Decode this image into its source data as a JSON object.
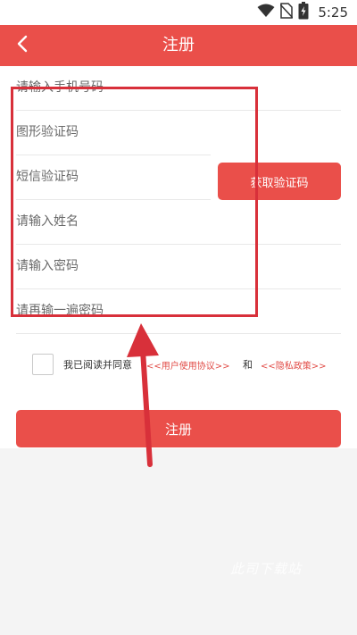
{
  "status_bar": {
    "time": "5:25",
    "icons": [
      "wifi-icon",
      "no-sim-icon",
      "battery-charging-icon"
    ]
  },
  "app_bar": {
    "back_icon": "chevron-left-icon",
    "title": "注册",
    "color": "#ea4f4a"
  },
  "form": {
    "phone_placeholder": "请输入手机号码",
    "captcha_placeholder": "图形验证码",
    "sms_code_placeholder": "短信验证码",
    "get_code_label": "获取验证码",
    "name_placeholder": "请输入姓名",
    "password_placeholder": "请输入密码",
    "confirm_password_placeholder": "请再输一遍密码"
  },
  "agreement": {
    "prefix": "我已阅读并同意",
    "user_agreement": "<<用户使用协议>>",
    "and": "和",
    "privacy_policy": "<<隐私政策>>"
  },
  "submit": {
    "label": "注册"
  },
  "annotation": {
    "box_color": "#d8303a"
  },
  "watermark": "此司下载站"
}
